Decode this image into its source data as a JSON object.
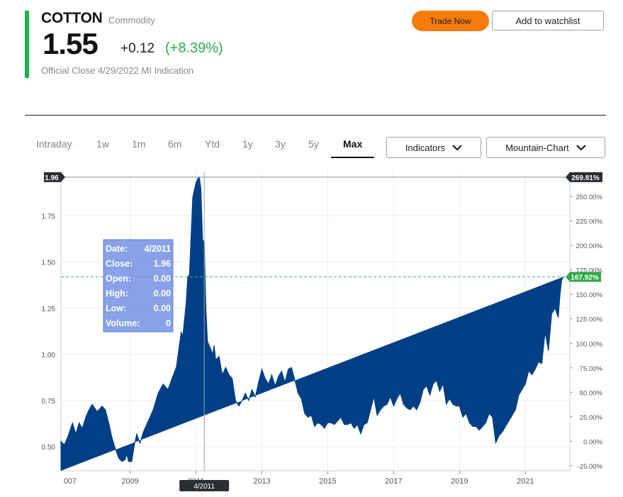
{
  "header": {
    "symbol": "COTTON",
    "asset_type": "Commodity",
    "price": "1.55",
    "change_abs": "+0.12",
    "change_pct": "(+8.39%)",
    "close_info": "Official Close 4/29/2022  MI Indication",
    "trade_label": "Trade Now",
    "watchlist_label": "Add to watchlist"
  },
  "colors": {
    "accent": "#22b04b",
    "trade": "#f57c0a",
    "area": "#003f86",
    "positive": "#2eaa4a"
  },
  "tabs": [
    {
      "label": "Intraday",
      "active": false
    },
    {
      "label": "1w",
      "active": false
    },
    {
      "label": "1m",
      "active": false
    },
    {
      "label": "6m",
      "active": false
    },
    {
      "label": "Ytd",
      "active": false
    },
    {
      "label": "1y",
      "active": false
    },
    {
      "label": "3y",
      "active": false
    },
    {
      "label": "5y",
      "active": false
    },
    {
      "label": "Max",
      "active": true
    }
  ],
  "dropdowns": {
    "indicators": "Indicators",
    "chart_type": "Mountain-Chart"
  },
  "chart_data": {
    "type": "area",
    "xlim": [
      2006.9,
      2022.35
    ],
    "ylim": [
      0.37,
      1.99
    ],
    "x_ticks": [
      2009,
      2011,
      2013,
      2015,
      2017,
      2019,
      2021
    ],
    "x_tick_labels": [
      "2009",
      "2011",
      "2013",
      "2015",
      "2017",
      "2019",
      "2021"
    ],
    "x_edge_label": "007",
    "y_ticks": [
      0.5,
      0.75,
      1.0,
      1.25,
      1.5,
      1.75
    ],
    "y_tick_labels": [
      "0.50",
      "0.75",
      "1.00",
      "1.25",
      "1.50",
      "1.75"
    ],
    "y2_labels": [
      "-25.00%",
      "0.00%",
      "25.00%",
      "50.00%",
      "75.00%",
      "100.00%",
      "125.00%",
      "150.00%",
      "175.00%",
      "200.00%",
      "225.00%",
      "250.00%"
    ],
    "y2_base": 0.53,
    "high_value": 1.96,
    "high_label": "1.96",
    "high_pct_label": "269.81%",
    "last_value": 1.42,
    "last_pct_label": "167.92%",
    "crosshair_x": 2011.25,
    "crosshair_label": "4/2011",
    "tooltip": [
      {
        "k": "Date:",
        "v": "4/2011"
      },
      {
        "k": "Close:",
        "v": "1.96"
      },
      {
        "k": "Open:",
        "v": "0.00"
      },
      {
        "k": "High:",
        "v": "0.00"
      },
      {
        "k": "Low:",
        "v": "0.00"
      },
      {
        "k": "Volume:",
        "v": "0"
      }
    ],
    "x": [
      2006.9,
      2007.0,
      2007.1,
      2007.25,
      2007.35,
      2007.45,
      2007.55,
      2007.65,
      2007.75,
      2007.85,
      2008.0,
      2008.15,
      2008.25,
      2008.35,
      2008.45,
      2008.55,
      2008.65,
      2008.75,
      2008.85,
      2008.9,
      2008.95,
      2009.05,
      2009.15,
      2009.2,
      2009.3,
      2009.4,
      2009.55,
      2009.7,
      2009.85,
      2010.0,
      2010.15,
      2010.25,
      2010.4,
      2010.55,
      2010.6,
      2010.7,
      2010.75,
      2010.8,
      2010.9,
      2011.0,
      2011.05,
      2011.1,
      2011.15,
      2011.2,
      2011.25,
      2011.3,
      2011.35,
      2011.4,
      2011.45,
      2011.5,
      2011.55,
      2011.6,
      2011.7,
      2011.8,
      2011.9,
      2012.0,
      2012.1,
      2012.2,
      2012.3,
      2012.4,
      2012.5,
      2012.6,
      2012.7,
      2012.8,
      2012.9,
      2013.0,
      2013.1,
      2013.2,
      2013.3,
      2013.4,
      2013.5,
      2013.6,
      2013.7,
      2013.8,
      2013.9,
      2014.0,
      2014.1,
      2014.2,
      2014.3,
      2014.4,
      2014.5,
      2014.6,
      2014.7,
      2014.8,
      2014.9,
      2015.0,
      2015.1,
      2015.2,
      2015.3,
      2015.4,
      2015.5,
      2015.6,
      2015.7,
      2015.8,
      2015.9,
      2016.0,
      2016.1,
      2016.2,
      2016.3,
      2016.4,
      2016.5,
      2016.6,
      2016.7,
      2016.8,
      2016.9,
      2017.0,
      2017.1,
      2017.2,
      2017.3,
      2017.4,
      2017.5,
      2017.6,
      2017.7,
      2017.8,
      2017.9,
      2018.0,
      2018.1,
      2018.2,
      2018.3,
      2018.4,
      2018.5,
      2018.6,
      2018.7,
      2018.8,
      2018.9,
      2019.0,
      2019.1,
      2019.2,
      2019.3,
      2019.4,
      2019.5,
      2019.6,
      2019.7,
      2019.8,
      2019.9,
      2020.0,
      2020.1,
      2020.2,
      2020.3,
      2020.4,
      2020.5,
      2020.6,
      2020.7,
      2020.8,
      2020.9,
      2021.0,
      2021.1,
      2021.2,
      2021.3,
      2021.4,
      2021.5,
      2021.6,
      2021.7,
      2021.8,
      2021.9,
      2022.0,
      2022.05,
      2022.1,
      2022.15,
      2022.2,
      2022.25,
      2022.3,
      2022.35
    ],
    "y": [
      0.53,
      0.51,
      0.55,
      0.63,
      0.57,
      0.63,
      0.6,
      0.66,
      0.7,
      0.73,
      0.69,
      0.72,
      0.7,
      0.63,
      0.55,
      0.49,
      0.44,
      0.42,
      0.43,
      0.46,
      0.42,
      0.42,
      0.53,
      0.57,
      0.52,
      0.58,
      0.64,
      0.7,
      0.79,
      0.84,
      0.81,
      0.86,
      0.93,
      1.12,
      1.1,
      1.28,
      1.42,
      1.43,
      1.85,
      1.93,
      1.95,
      1.96,
      1.9,
      1.62,
      1.61,
      1.25,
      1.07,
      1.05,
      1.03,
      1.0,
      1.05,
      0.97,
      0.99,
      0.89,
      0.93,
      0.89,
      0.87,
      0.75,
      0.72,
      0.75,
      0.79,
      0.75,
      0.81,
      0.77,
      0.85,
      0.92,
      0.87,
      0.84,
      0.89,
      0.83,
      0.88,
      0.91,
      0.85,
      0.92,
      0.93,
      0.86,
      0.79,
      0.76,
      0.68,
      0.66,
      0.67,
      0.61,
      0.63,
      0.62,
      0.6,
      0.63,
      0.63,
      0.62,
      0.64,
      0.66,
      0.62,
      0.62,
      0.63,
      0.6,
      0.62,
      0.57,
      0.62,
      0.63,
      0.7,
      0.77,
      0.67,
      0.7,
      0.72,
      0.73,
      0.77,
      0.72,
      0.76,
      0.79,
      0.73,
      0.71,
      0.7,
      0.72,
      0.7,
      0.74,
      0.81,
      0.83,
      0.78,
      0.84,
      0.86,
      0.8,
      0.84,
      0.73,
      0.76,
      0.73,
      0.72,
      0.72,
      0.66,
      0.68,
      0.63,
      0.61,
      0.61,
      0.59,
      0.61,
      0.63,
      0.68,
      0.66,
      0.52,
      0.56,
      0.58,
      0.61,
      0.64,
      0.67,
      0.7,
      0.78,
      0.81,
      0.84,
      0.91,
      0.89,
      0.92,
      0.96,
      0.95,
      1.12,
      1.02,
      1.22,
      1.25,
      1.2,
      1.32,
      1.4,
      1.42
    ]
  }
}
